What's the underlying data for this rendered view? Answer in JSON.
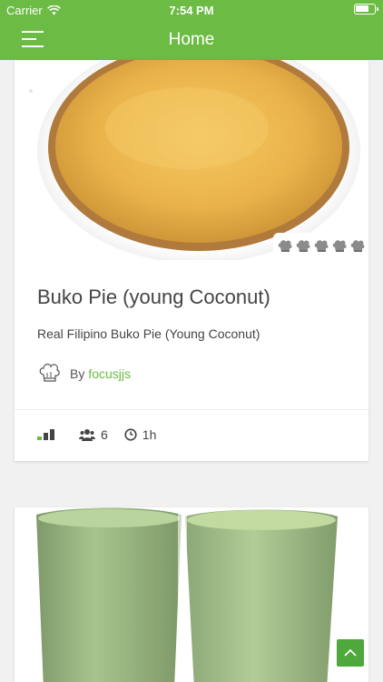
{
  "status_bar": {
    "carrier": "Carrier",
    "time": "7:54 PM"
  },
  "header": {
    "title": "Home"
  },
  "recipes": [
    {
      "title": "Buko Pie (young Coconut)",
      "description": "Real Filipino Buko Pie (Young Coconut)",
      "author_prefix": "By",
      "author": "focusjjs",
      "rating": 5,
      "difficulty_level": 1,
      "servings": "6",
      "time": "1h"
    },
    {
      "image": "green drinks"
    }
  ],
  "colors": {
    "accent": "#6bbb44",
    "scroll_button": "#4ea83b"
  },
  "icons": [
    "menu-icon",
    "wifi-icon",
    "battery-icon",
    "chef-hat-icon",
    "difficulty-icon",
    "people-icon",
    "clock-icon",
    "chevron-up-icon"
  ]
}
